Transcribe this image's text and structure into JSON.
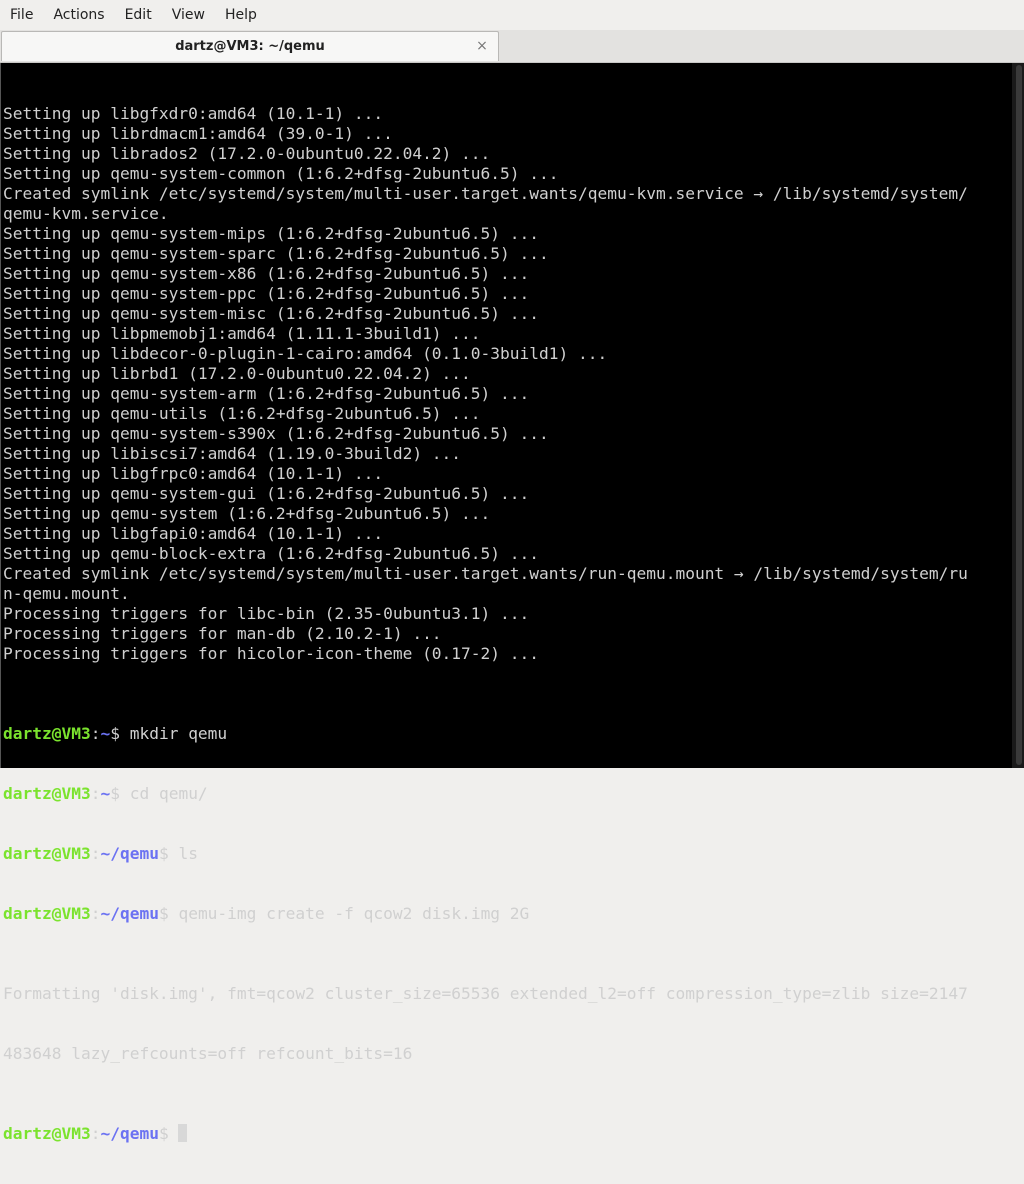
{
  "menubar": {
    "items": [
      "File",
      "Actions",
      "Edit",
      "View",
      "Help"
    ]
  },
  "tab": {
    "title": "dartz@VM3: ~/qemu",
    "close_icon": "×"
  },
  "terminal": {
    "output_lines": [
      "Setting up libgfxdr0:amd64 (10.1-1) ...",
      "Setting up librdmacm1:amd64 (39.0-1) ...",
      "Setting up librados2 (17.2.0-0ubuntu0.22.04.2) ...",
      "Setting up qemu-system-common (1:6.2+dfsg-2ubuntu6.5) ...",
      "Created symlink /etc/systemd/system/multi-user.target.wants/qemu-kvm.service → /lib/systemd/system/",
      "qemu-kvm.service.",
      "Setting up qemu-system-mips (1:6.2+dfsg-2ubuntu6.5) ...",
      "Setting up qemu-system-sparc (1:6.2+dfsg-2ubuntu6.5) ...",
      "Setting up qemu-system-x86 (1:6.2+dfsg-2ubuntu6.5) ...",
      "Setting up qemu-system-ppc (1:6.2+dfsg-2ubuntu6.5) ...",
      "Setting up qemu-system-misc (1:6.2+dfsg-2ubuntu6.5) ...",
      "Setting up libpmemobj1:amd64 (1.11.1-3build1) ...",
      "Setting up libdecor-0-plugin-1-cairo:amd64 (0.1.0-3build1) ...",
      "Setting up librbd1 (17.2.0-0ubuntu0.22.04.2) ...",
      "Setting up qemu-system-arm (1:6.2+dfsg-2ubuntu6.5) ...",
      "Setting up qemu-utils (1:6.2+dfsg-2ubuntu6.5) ...",
      "Setting up qemu-system-s390x (1:6.2+dfsg-2ubuntu6.5) ...",
      "Setting up libiscsi7:amd64 (1.19.0-3build2) ...",
      "Setting up libgfrpc0:amd64 (10.1-1) ...",
      "Setting up qemu-system-gui (1:6.2+dfsg-2ubuntu6.5) ...",
      "Setting up qemu-system (1:6.2+dfsg-2ubuntu6.5) ...",
      "Setting up libgfapi0:amd64 (10.1-1) ...",
      "Setting up qemu-block-extra (1:6.2+dfsg-2ubuntu6.5) ...",
      "Created symlink /etc/systemd/system/multi-user.target.wants/run-qemu.mount → /lib/systemd/system/ru",
      "n-qemu.mount.",
      "Processing triggers for libc-bin (2.35-0ubuntu3.1) ...",
      "Processing triggers for man-db (2.10.2-1) ...",
      "Processing triggers for hicolor-icon-theme (0.17-2) ..."
    ],
    "prompt_user": "dartz@VM3",
    "commands": [
      {
        "path": "~",
        "cmd": " mkdir qemu"
      },
      {
        "path": "~",
        "cmd": " cd qemu/"
      },
      {
        "path": "~/qemu",
        "cmd": " ls"
      },
      {
        "path": "~/qemu",
        "cmd": " qemu-img create -f qcow2 disk.img 2G"
      }
    ],
    "result_lines": [
      "Formatting 'disk.img', fmt=qcow2 cluster_size=65536 extended_l2=off compression_type=zlib size=2147",
      "483648 lazy_refcounts=off refcount_bits=16"
    ],
    "final_prompt_path": "~/qemu",
    "colors": {
      "background": "#000000",
      "text": "#d0d0d0",
      "prompt_user": "#7be32e",
      "prompt_path": "#6b72f2"
    }
  }
}
